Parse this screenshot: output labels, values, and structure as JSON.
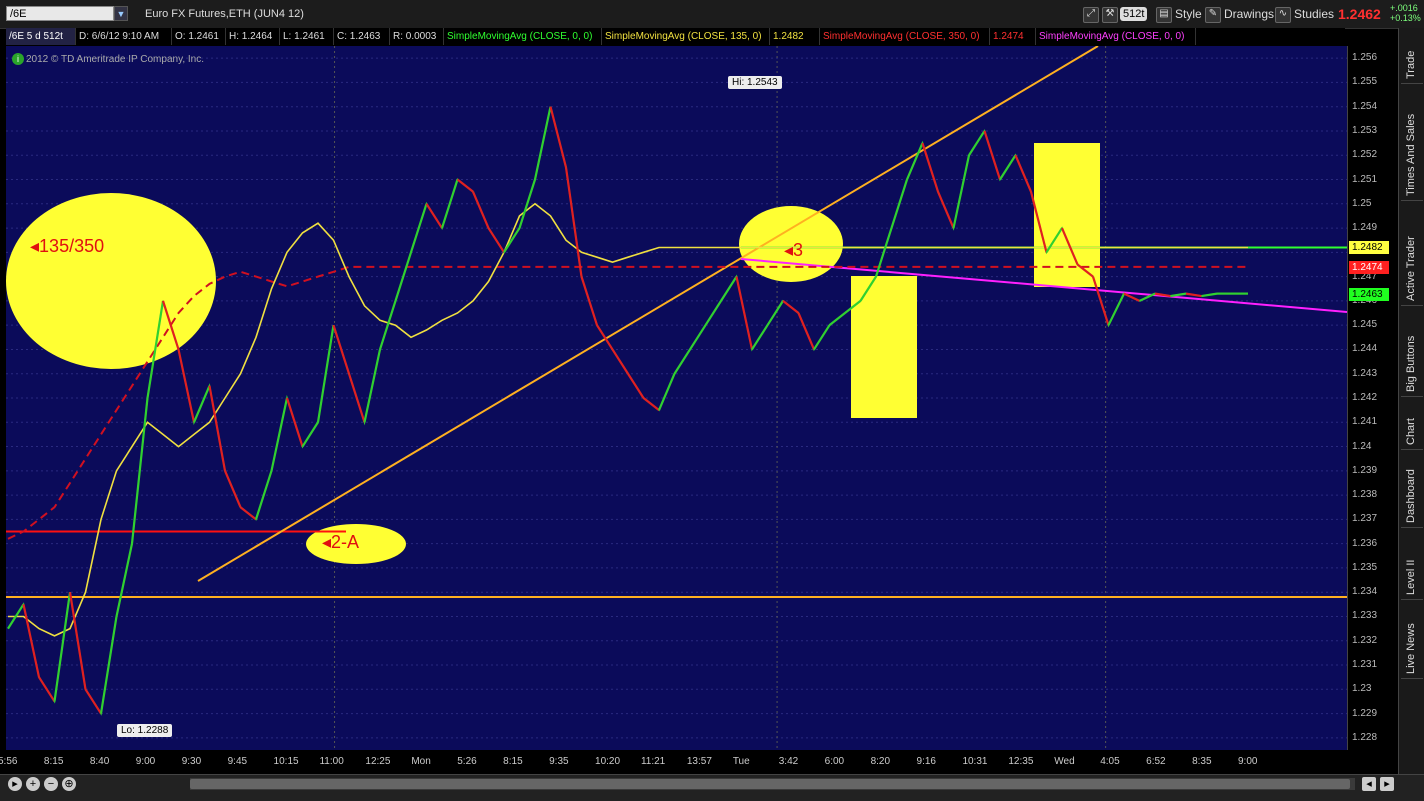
{
  "toolbar": {
    "symbol": "/6E",
    "description": "Euro FX Futures,ETH (JUN4 12)",
    "aggregation": "512t",
    "style_label": "Style",
    "drawings_label": "Drawings",
    "studies_label": "Studies",
    "last_price": "1.2462",
    "change_abs": "+.0016",
    "change_pct": "+0.13%"
  },
  "header": {
    "symbol_period": "/6E 5 d 512t",
    "date": "D: 6/6/12 9:10 AM",
    "open": "O: 1.2461",
    "high": "H: 1.2464",
    "low": "L: 1.2461",
    "close": "C: 1.2463",
    "range": "R: 0.0003",
    "study1": "SimpleMovingAvg (CLOSE, 0, 0)",
    "study2": "SimpleMovingAvg (CLOSE, 135, 0)",
    "study2_value": "1.2482",
    "study3": "SimpleMovingAvg (CLOSE, 350, 0)",
    "study3_value": "1.2474",
    "study4": "SimpleMovingAvg (CLOSE, 0, 0)"
  },
  "copyright": "2012 © TD Ameritrade IP Company, Inc.",
  "callouts": {
    "hi": "Hi: 1.2543",
    "lo": "Lo: 1.2288"
  },
  "annotations": {
    "a1": "135/350",
    "a2": "2-A",
    "a3": "3"
  },
  "price_tags": [
    {
      "value": "1.2482",
      "bg": "#ffff40",
      "fg": "#000000"
    },
    {
      "value": "1.2474",
      "bg": "#ff2020",
      "fg": "#ffffff"
    },
    {
      "value": "1.2463",
      "bg": "#20ff20",
      "fg": "#000000"
    }
  ],
  "side_tabs": [
    "Trade",
    "Times And Sales",
    "Active Trader",
    "Big Buttons",
    "Chart",
    "Dashboard",
    "Level II",
    "Live News"
  ],
  "colors": {
    "background": "#0b0b5a",
    "sma135": "#f0e040",
    "sma350": "#d01020",
    "trendline": "#ffb020",
    "magenta": "#ff20ff",
    "green_line": "#30ff30",
    "highlight": "#ffff33"
  },
  "chart_data": {
    "type": "line",
    "title": "",
    "ylim": [
      1.2275,
      1.2565
    ],
    "y_ticks": [
      "1.256",
      "1.255",
      "1.254",
      "1.253",
      "1.252",
      "1.251",
      "1.25",
      "1.249",
      "1.248",
      "1.247",
      "1.246",
      "1.245",
      "1.244",
      "1.243",
      "1.242",
      "1.241",
      "1.24",
      "1.239",
      "1.238",
      "1.237",
      "1.236",
      "1.235",
      "1.234",
      "1.233",
      "1.232",
      "1.231",
      "1.23",
      "1.229",
      "1.228"
    ],
    "x_ticks": [
      "5:56",
      "8:15",
      "8:40",
      "9:00",
      "9:30",
      "9:45",
      "10:15",
      "11:00",
      "12:25",
      "Mon",
      "5:26",
      "8:15",
      "9:35",
      "10:20",
      "11:21",
      "13:57",
      "Tue",
      "3:42",
      "6:00",
      "8:20",
      "9:16",
      "10:31",
      "12:35",
      "Wed",
      "4:05",
      "6:52",
      "8:35",
      "9:00"
    ],
    "x": [
      0,
      3,
      6,
      9,
      12,
      15,
      18,
      21,
      24,
      27,
      30,
      33,
      36,
      39,
      42,
      45,
      48,
      51,
      54,
      57,
      60,
      63,
      66,
      69,
      72,
      75,
      78,
      81,
      84,
      87,
      90,
      93,
      96,
      99,
      102,
      105,
      108,
      111,
      114,
      117,
      120,
      123,
      126,
      129,
      132,
      135,
      138,
      141,
      144,
      147,
      150,
      153,
      156,
      159,
      162,
      165,
      168,
      171,
      174,
      177,
      180,
      183,
      186,
      189,
      192,
      195,
      198,
      201,
      204,
      207,
      210,
      213,
      216,
      219,
      222,
      225,
      228,
      231,
      234,
      237,
      240
    ],
    "series": [
      {
        "values": [
          1.2325,
          1.2335,
          1.2305,
          1.2295,
          1.234,
          1.23,
          1.229,
          1.233,
          1.236,
          1.242,
          1.246,
          1.244,
          1.241,
          1.2425,
          1.239,
          1.2375,
          1.237,
          1.239,
          1.242,
          1.24,
          1.241,
          1.245,
          1.243,
          1.241,
          1.244,
          1.246,
          1.248,
          1.25,
          1.249,
          1.251,
          1.2505,
          1.249,
          1.248,
          1.249,
          1.251,
          1.254,
          1.2515,
          1.247,
          1.245,
          1.244,
          1.243,
          1.242,
          1.2415,
          1.243,
          1.244,
          1.245,
          1.246,
          1.247,
          1.244,
          1.245,
          1.246,
          1.2455,
          1.244,
          1.245,
          1.2455,
          1.246,
          1.247,
          1.249,
          1.251,
          1.2525,
          1.2505,
          1.249,
          1.252,
          1.253,
          1.251,
          1.252,
          1.2505,
          1.248,
          1.249,
          1.2475,
          1.247,
          1.245,
          1.2463,
          1.246,
          1.2463,
          1.2462,
          1.2463,
          1.2462,
          1.2463,
          1.2463,
          1.2463
        ]
      },
      {
        "values": [
          1.233,
          1.233,
          1.2325,
          1.2322,
          1.2325,
          1.234,
          1.237,
          1.239,
          1.24,
          1.241,
          1.2405,
          1.24,
          1.2405,
          1.241,
          1.242,
          1.243,
          1.2445,
          1.2465,
          1.248,
          1.2488,
          1.2492,
          1.2485,
          1.247,
          1.2458,
          1.2452,
          1.245,
          1.2445,
          1.2448,
          1.2452,
          1.2455,
          1.246,
          1.2468,
          1.248,
          1.2495,
          1.25,
          1.2495,
          1.2485,
          1.248,
          1.2478,
          1.2476,
          1.2478,
          1.248,
          1.2482,
          1.2482,
          1.2482,
          1.2482,
          1.2482,
          1.2482,
          1.2482,
          1.2482,
          1.2482,
          1.2482,
          1.2482,
          1.2482,
          1.2482,
          1.2482,
          1.2482,
          1.2482,
          1.2482,
          1.2482,
          1.2482,
          1.2482,
          1.2482,
          1.2482,
          1.2482,
          1.2482,
          1.2482,
          1.2482,
          1.2482,
          1.2482,
          1.2482,
          1.2482,
          1.2482,
          1.2482,
          1.2482,
          1.2482,
          1.2482,
          1.2482,
          1.2482,
          1.2482,
          1.2482
        ]
      },
      {
        "values": [
          1.2362,
          1.2365,
          1.237,
          1.2375,
          1.2385,
          1.2395,
          1.2405,
          1.2415,
          1.2425,
          1.2435,
          1.2445,
          1.2455,
          1.2462,
          1.2467,
          1.247,
          1.2472,
          1.247,
          1.2468,
          1.2466,
          1.2468,
          1.247,
          1.2472,
          1.2474,
          1.2474,
          1.2474,
          1.2474,
          1.2474,
          1.2474,
          1.2474,
          1.2474,
          1.2474,
          1.2474,
          1.2474,
          1.2474,
          1.2474,
          1.2474,
          1.2474,
          1.2474,
          1.2474,
          1.2474,
          1.2474,
          1.2474,
          1.2474,
          1.2474,
          1.2474,
          1.2474,
          1.2474,
          1.2474,
          1.2474,
          1.2474,
          1.2474,
          1.2474,
          1.2474,
          1.2474,
          1.2474,
          1.2474,
          1.2474,
          1.2474,
          1.2474,
          1.2474,
          1.2474,
          1.2474,
          1.2474,
          1.2474,
          1.2474,
          1.2474,
          1.2474,
          1.2474,
          1.2474,
          1.2474,
          1.2474,
          1.2474,
          1.2474,
          1.2474,
          1.2474,
          1.2474,
          1.2474,
          1.2474,
          1.2474,
          1.2474,
          1.2474
        ]
      }
    ],
    "hlines": [
      1.2338,
      1.2365,
      1.2482
    ],
    "grid": true
  }
}
